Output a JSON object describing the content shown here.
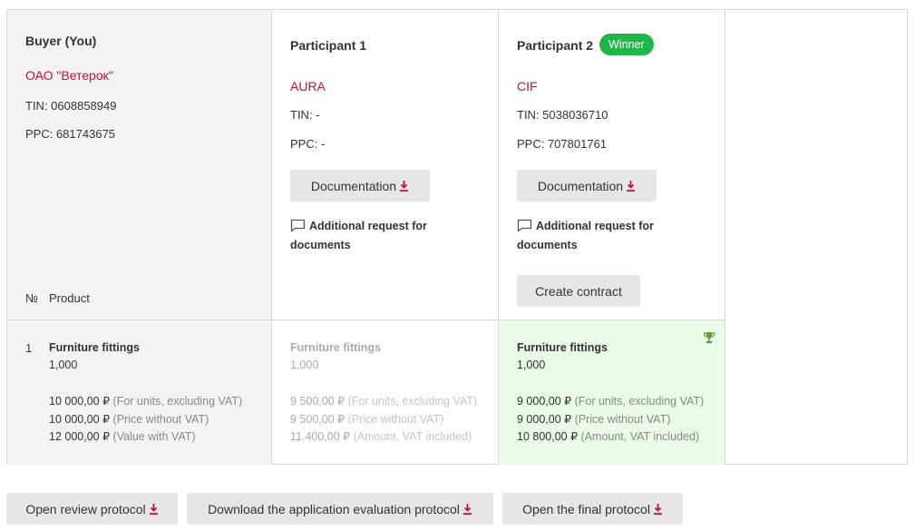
{
  "buyer": {
    "header": "Buyer (You)",
    "company": "ОАО \"Ветерок\"",
    "tin": "TIN: 0608858949",
    "ppc": "PPC: 681743675",
    "col_no": "№",
    "col_product": "Product"
  },
  "participants": [
    {
      "header": "Participant 1",
      "company": "AURA",
      "tin": "TIN: -",
      "ppc": "PPC: -",
      "documentation_label": "Documentation",
      "request_label_1": "Additional request for",
      "request_label_2": "documents",
      "product": {
        "name": "Furniture fittings",
        "qty": "1,000",
        "unit_price": "9 500,00 ₽",
        "unit_price_note": "(For units, excluding VAT)",
        "price_no_vat": "9 500,00 ₽",
        "price_no_vat_note": "(Price without VAT)",
        "price_vat": "11 400,00 ₽",
        "price_vat_note": "(Amount, VAT included)"
      }
    },
    {
      "header": "Participant 2",
      "badge": "Winner",
      "company": "CIF",
      "tin": "TIN: 5038036710",
      "ppc": "PPC: 707801761",
      "documentation_label": "Documentation",
      "request_label_1": "Additional request for",
      "request_label_2": "documents",
      "create_contract_label": "Create contract",
      "product": {
        "name": "Furniture fittings",
        "qty": "1,000",
        "unit_price": "9 000,00 ₽",
        "unit_price_note": "(For units, excluding VAT)",
        "price_no_vat": "9 000,00 ₽",
        "price_no_vat_note": "(Price without VAT)",
        "price_vat": "10 800,00 ₽",
        "price_vat_note": "(Amount, VAT included)"
      }
    }
  ],
  "buyer_product": {
    "no": "1",
    "name": "Furniture fittings",
    "qty": "1,000",
    "unit_price": "10 000,00 ₽",
    "unit_price_note": "(For units, excluding VAT)",
    "price_no_vat": "10 000,00 ₽",
    "price_no_vat_note": "(Price without VAT)",
    "price_vat": "12 000,00 ₽",
    "price_vat_note": "(Value with VAT)"
  },
  "footer_buttons": {
    "review": "Open review protocol",
    "evaluation": "Download the application evaluation protocol",
    "final": "Open the final protocol"
  },
  "colors": {
    "accent_red": "#c8102e",
    "winner_green": "#1fb548",
    "winner_bg": "#eafbe7",
    "buyer_bg": "#f3f3f3"
  },
  "icons": [
    "download-icon",
    "chat-icon",
    "trophy-icon"
  ]
}
